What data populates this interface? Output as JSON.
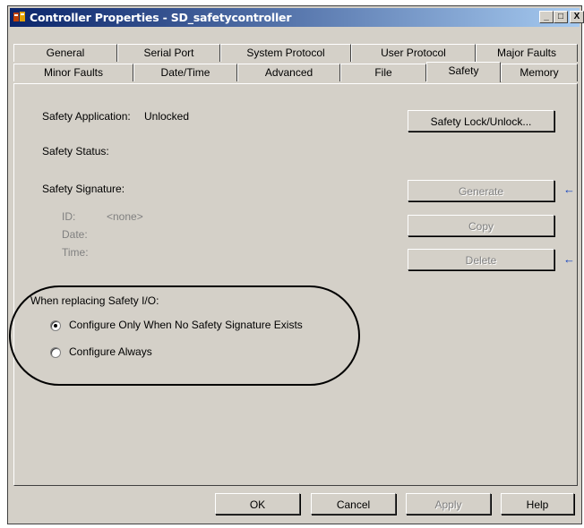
{
  "window": {
    "title": "Controller Properties - SD_safetycontroller",
    "minimize": "_",
    "maximize": "□",
    "close": "X"
  },
  "tabs_row1": [
    "General",
    "Serial Port",
    "System Protocol",
    "User Protocol",
    "Major Faults"
  ],
  "tabs_row2": [
    "Minor Faults",
    "Date/Time",
    "Advanced",
    "File",
    "Safety",
    "Memory"
  ],
  "active_tab": "Safety",
  "safety": {
    "application_label": "Safety Application:",
    "application_value": "Unlocked",
    "lock_button": "Safety Lock/Unlock...",
    "status_label": "Safety Status:",
    "signature_label": "Safety Signature:",
    "id_label": "ID:",
    "id_value": "<none>",
    "date_label": "Date:",
    "time_label": "Time:",
    "generate_button": "Generate",
    "copy_button": "Copy",
    "delete_button": "Delete"
  },
  "replacing": {
    "label": "When replacing Safety I/O:",
    "option1": "Configure Only When No Safety Signature Exists",
    "option2": "Configure Always",
    "selected": 1
  },
  "footer": {
    "ok": "OK",
    "cancel": "Cancel",
    "apply": "Apply",
    "help": "Help"
  },
  "colors": {
    "titlebar_start": "#0a246a",
    "titlebar_end": "#a6caf0",
    "face": "#d4d0c8",
    "arrow": "#1040c0"
  }
}
